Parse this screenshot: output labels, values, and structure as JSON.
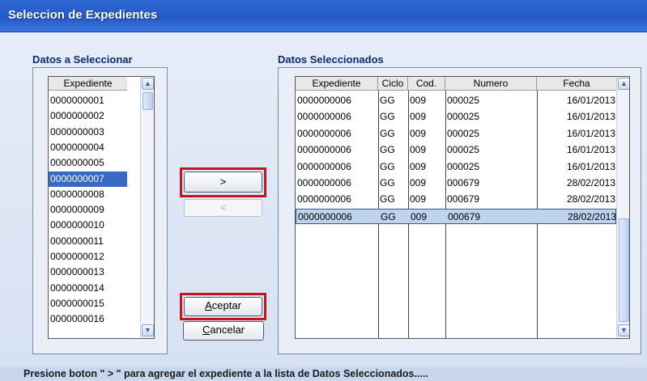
{
  "window": {
    "title": "Seleccion de Expedientes"
  },
  "left": {
    "label": "Datos a Seleccionar",
    "header": "Expediente",
    "items": [
      "0000000001",
      "0000000002",
      "0000000003",
      "0000000004",
      "0000000005",
      "0000000007",
      "0000000008",
      "0000000009",
      "0000000010",
      "0000000011",
      "0000000012",
      "0000000013",
      "0000000014",
      "0000000015",
      "0000000016"
    ],
    "selected_index": 5
  },
  "right": {
    "label": "Datos Seleccionados",
    "headers": [
      "Expediente",
      "Ciclo",
      "Cod.",
      "Numero",
      "Fecha"
    ],
    "rows": [
      [
        "0000000006",
        "GG",
        "009",
        "000025",
        "16/01/2013"
      ],
      [
        "0000000006",
        "GG",
        "009",
        "000025",
        "16/01/2013"
      ],
      [
        "0000000006",
        "GG",
        "009",
        "000025",
        "16/01/2013"
      ],
      [
        "0000000006",
        "GG",
        "009",
        "000025",
        "16/01/2013"
      ],
      [
        "0000000006",
        "GG",
        "009",
        "000025",
        "16/01/2013"
      ],
      [
        "0000000006",
        "GG",
        "009",
        "000679",
        "28/02/2013"
      ],
      [
        "0000000006",
        "GG",
        "009",
        "000679",
        "28/02/2013"
      ],
      [
        "0000000006",
        "GG",
        "009",
        "000679",
        "28/02/2013"
      ]
    ],
    "selected_index": 7
  },
  "buttons": {
    "add": ">",
    "remove": "<",
    "accept": "Aceptar",
    "cancel": "Cancelar"
  },
  "status": "Presione boton \" > \" para agregar el expediente a la lista de Datos Seleccionados.....",
  "icons": {
    "scroll_up": "chevron-up-icon",
    "scroll_down": "chevron-down-icon"
  },
  "colors": {
    "title_bar": "#2f67d3",
    "selection": "#3668c4",
    "highlight_box": "#c4151c"
  }
}
